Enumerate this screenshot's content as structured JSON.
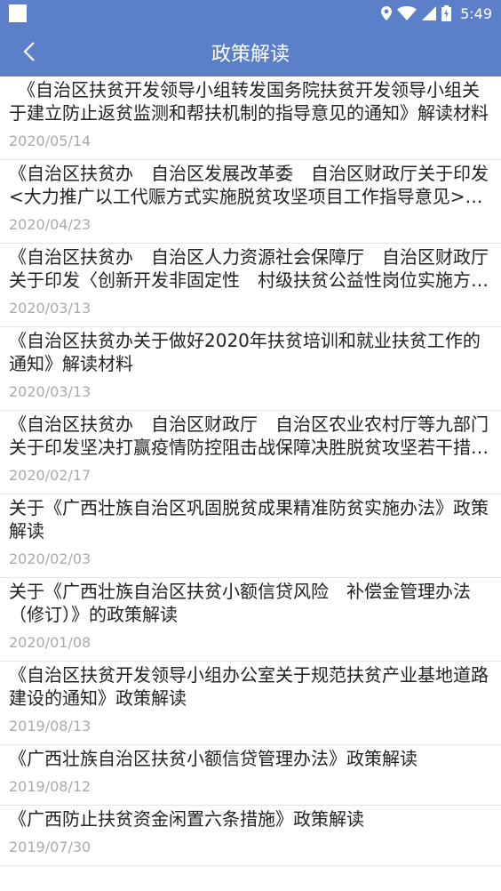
{
  "status_bar": {
    "time": "5:49",
    "icons": [
      "location-icon",
      "wifi-icon",
      "signal-icon",
      "battery-icon"
    ]
  },
  "header": {
    "title": "政策解读",
    "back_icon": "chevron-left-icon",
    "color": "#5b7fc9"
  },
  "items": [
    {
      "title": "　《自治区扶贫开发领导小组转发国务院扶贫开发领导小组关于建立防止返贫监测和帮扶机制的指导意见的通知》解读材料",
      "date": "2020/05/14"
    },
    {
      "title": "《自治区扶贫办　自治区发展改革委　自治区财政厅关于印发<大力推广以工代赈方式实施脱贫攻坚项目工作指导意见>的通知》解读材料",
      "date": "2020/04/23"
    },
    {
      "title": "《自治区扶贫办　自治区人力资源社会保障厅　自治区财政厅关于印发〈创新开发非固定性　村级扶贫公益性岗位实施方案〉的通知》解读",
      "date": "2020/03/13"
    },
    {
      "title": "《自治区扶贫办关于做好2020年扶贫培训和就业扶贫工作的通知》解读材料",
      "date": "2020/03/13"
    },
    {
      "title": "《自治区扶贫办　自治区财政厅　自治区农业农村厅等九部门关于印发坚决打赢疫情防控阻击战保障决胜脱贫攻坚若干措施的通知》解读",
      "date": "2020/02/17"
    },
    {
      "title": "关于《广西壮族自治区巩固脱贫成果精准防贫实施办法》政策解读",
      "date": "2020/02/03"
    },
    {
      "title": "关于《广西壮族自治区扶贫小额信贷风险　补偿金管理办法（修订）》的政策解读",
      "date": "2020/01/08"
    },
    {
      "title": "《自治区扶贫开发领导小组办公室关于规范扶贫产业基地道路建设的通知》政策解读",
      "date": "2019/08/13"
    },
    {
      "title": "《广西壮族自治区扶贫小额信贷管理办法》政策解读",
      "date": "2019/08/12"
    },
    {
      "title": "《广西防止扶贫资金闲置六条措施》政策解读",
      "date": "2019/07/30"
    }
  ]
}
